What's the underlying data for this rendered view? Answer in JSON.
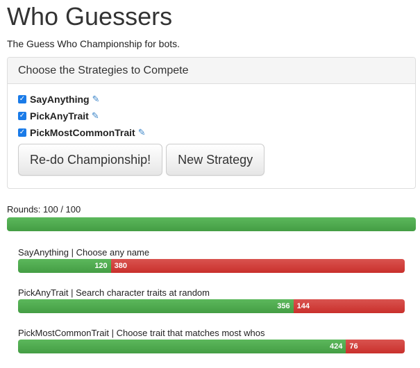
{
  "header": {
    "title": "Who Guessers",
    "subtitle": "The Guess Who Championship for bots."
  },
  "panel": {
    "title": "Choose the Strategies to Compete",
    "strategies": [
      {
        "name": "SayAnything",
        "checked": true
      },
      {
        "name": "PickAnyTrait",
        "checked": true
      },
      {
        "name": "PickMostCommonTrait",
        "checked": true
      }
    ],
    "redo_label": "Re-do Championship!",
    "new_label": "New Strategy"
  },
  "rounds": {
    "label": "Rounds: 100 / 100",
    "fraction": 1.0
  },
  "results": [
    {
      "label": "SayAnything | Choose any name",
      "wins": "120",
      "losses": "380"
    },
    {
      "label": "PickAnyTrait | Search character traits at random",
      "wins": "356",
      "losses": "144"
    },
    {
      "label": "PickMostCommonTrait | Choose trait that matches most whos",
      "wins": "424",
      "losses": "76"
    }
  ],
  "colors": {
    "win": "#5cb85c",
    "loss": "#d9534f",
    "checkbox": "#1a7be8",
    "edit_icon": "#3a84c8"
  },
  "icons": {
    "checkbox": "checkbox-checked-icon",
    "edit": "edit-pencil-icon"
  }
}
